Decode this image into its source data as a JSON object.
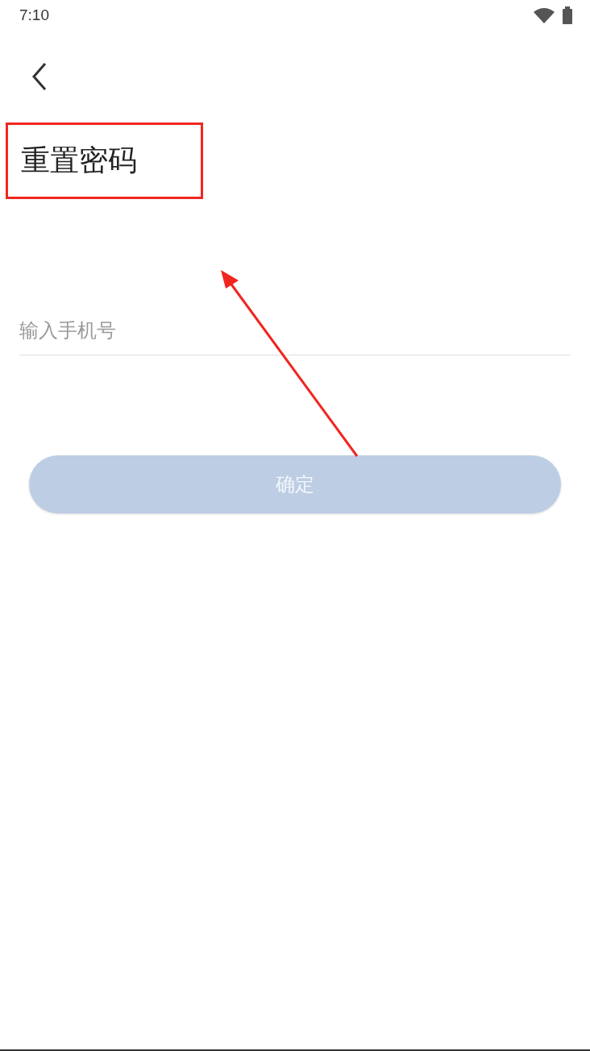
{
  "status_bar": {
    "time": "7:10"
  },
  "title": "重置密码",
  "phone_field": {
    "placeholder": "输入手机号"
  },
  "confirm_button": {
    "label": "确定",
    "disabled": true
  }
}
